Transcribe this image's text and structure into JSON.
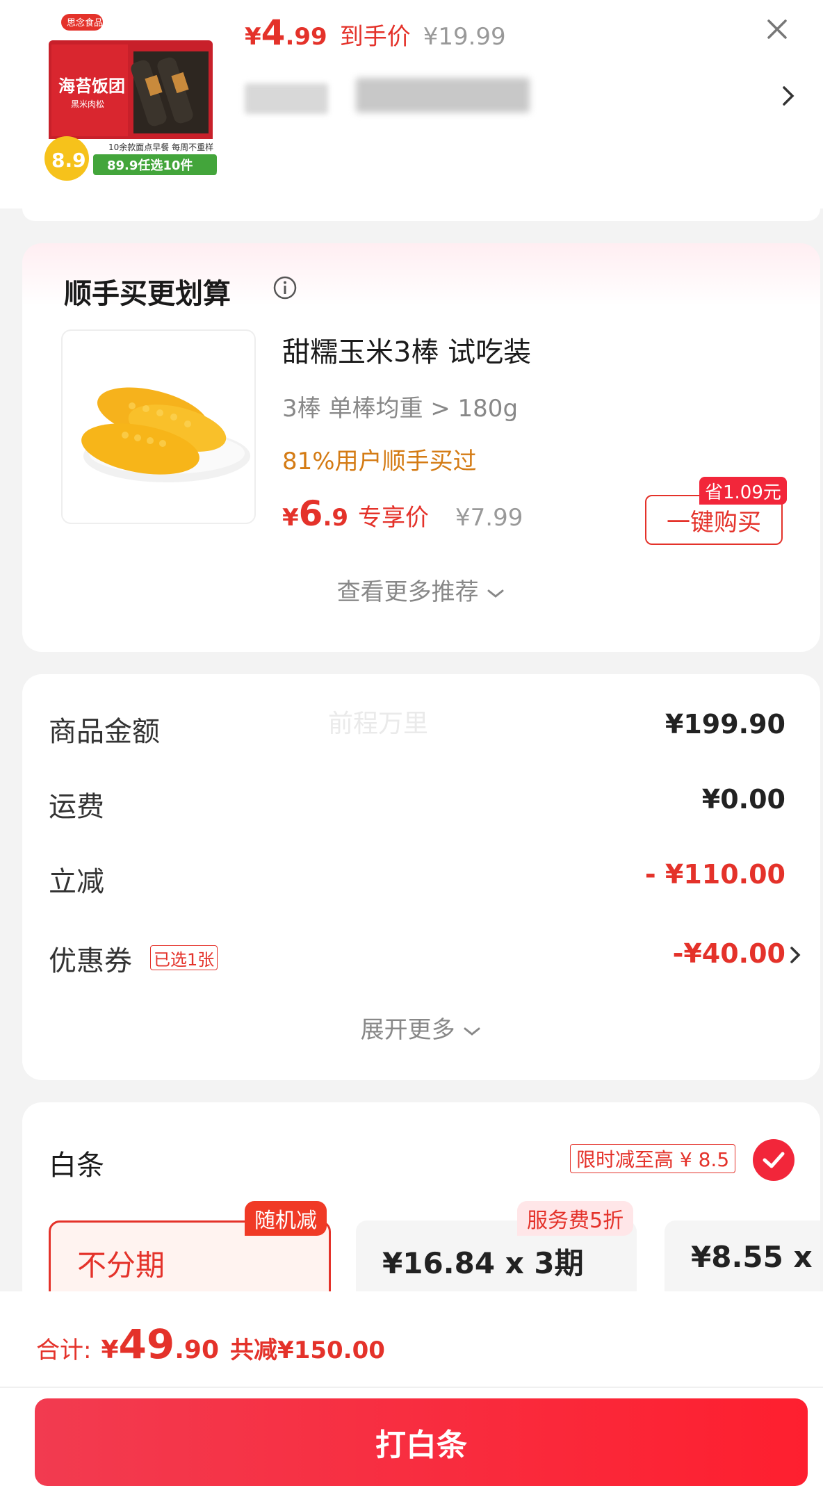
{
  "top_product": {
    "package_brand": "思念食品",
    "package_name": "海苔饭团",
    "package_sub": "黑米肉松",
    "package_badge": "8.9",
    "package_promo": "10余款面点早餐 每周不重样",
    "package_offer": "89.9任选10件",
    "price_currency": "¥",
    "price_int": "4",
    "price_dec": ".99",
    "price_label": "到手价",
    "original_price": "¥19.99"
  },
  "recommend": {
    "title": "顺手买更划算",
    "product_name": "甜糯玉米3棒 试吃装",
    "spec": "3棒 单棒均重 > 180g",
    "social_proof": "81%用户顺手买过",
    "price_currency": "¥",
    "price_int": "6",
    "price_dec": ".9",
    "price_label": "专享价",
    "original_price": "¥7.99",
    "save_tag": "省1.09元",
    "buy_button": "一键购买",
    "more_link": "查看更多推荐"
  },
  "summary": {
    "watermark": "前程万里",
    "rows": [
      {
        "label": "商品金额",
        "value": "¥199.90"
      },
      {
        "label": "运费",
        "value": "¥0.00"
      },
      {
        "label": "立减",
        "value": "- ¥110.00"
      },
      {
        "label": "优惠券",
        "tag": "已选1张",
        "value": "-¥40.00"
      }
    ],
    "expand_more": "展开更多"
  },
  "baitiao": {
    "title": "白条",
    "promo_tag": "限时减至高 ¥ 8.5",
    "plans": [
      {
        "text": "不分期",
        "badge": "随机减"
      },
      {
        "text": "¥16.84 x 3期",
        "badge": "服务费5折"
      },
      {
        "text": "¥8.55 x"
      }
    ]
  },
  "bottom": {
    "total_label": "合计:",
    "total_currency": "¥",
    "total_int": "49",
    "total_dec": ".90",
    "total_saved": "共减¥150.00",
    "pay_button": "打白条"
  },
  "colors": {
    "accent": "#e4322a",
    "orange": "#d47b14",
    "pay_gradient_start": "#f23b50",
    "pay_gradient_end": "#fe1f2f"
  }
}
